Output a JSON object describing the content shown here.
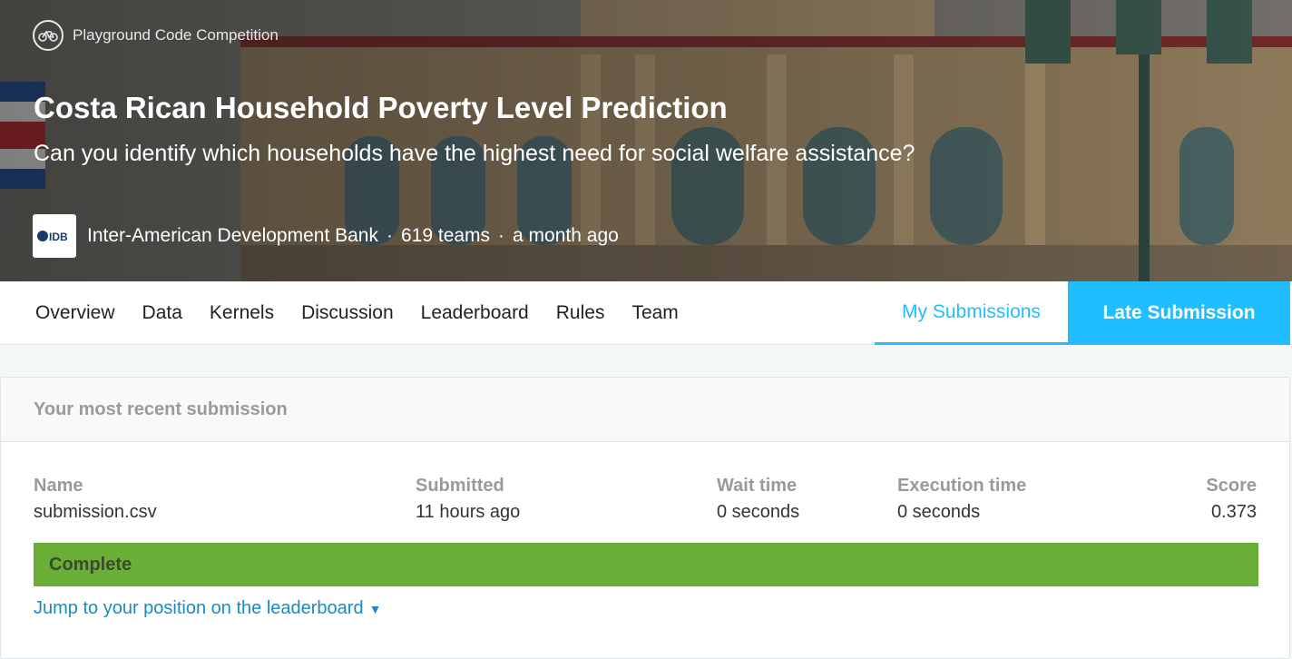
{
  "banner": {
    "competition_type": "Playground Code Competition",
    "competition_type_icon": "bicycle-icon",
    "title": "Costa Rican Household Poverty Level Prediction",
    "subtitle": "Can you identify which households have the highest need for social welfare assistance?",
    "host_logo_text": "IDB",
    "host_name": "Inter-American Development Bank",
    "separator": "·",
    "teams": "619 teams",
    "time_ago": "a month ago"
  },
  "tabs": {
    "items": [
      "Overview",
      "Data",
      "Kernels",
      "Discussion",
      "Leaderboard",
      "Rules",
      "Team"
    ],
    "my_submissions": "My Submissions",
    "late_submission": "Late Submission"
  },
  "submission": {
    "header": "Your most recent submission",
    "columns": {
      "name": "Name",
      "submitted": "Submitted",
      "wait_time": "Wait time",
      "execution_time": "Execution time",
      "score": "Score"
    },
    "values": {
      "name": "submission.csv",
      "submitted": "11 hours ago",
      "wait_time": "0 seconds",
      "execution_time": "0 seconds",
      "score": "0.373"
    },
    "status": "Complete",
    "jump_link": "Jump to your position on the leaderboard"
  },
  "colors": {
    "accent": "#20beff",
    "complete": "#6aae37",
    "link": "#1a8bbf"
  }
}
